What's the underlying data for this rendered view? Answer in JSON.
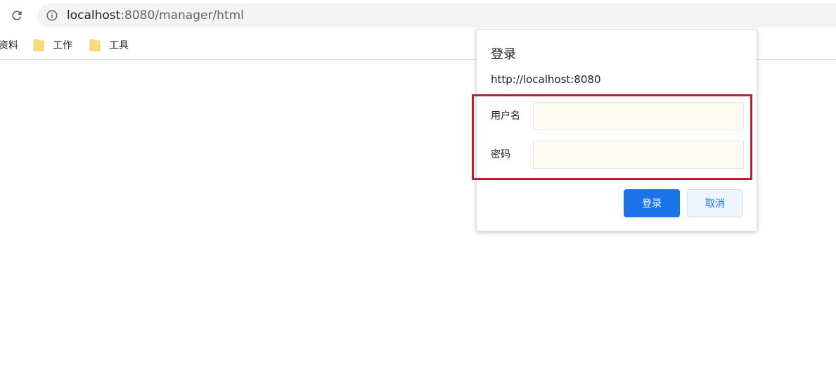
{
  "browser": {
    "url_host": "localhost",
    "url_rest": ":8080/manager/html"
  },
  "bookmarks": [
    {
      "label": "资料"
    },
    {
      "label": "工作"
    },
    {
      "label": "工具"
    }
  ],
  "dialog": {
    "title": "登录",
    "origin": "http://localhost:8080",
    "username_label": "用户名",
    "username_value": "",
    "password_label": "密码",
    "password_value": "",
    "submit_label": "登录",
    "cancel_label": "取消"
  },
  "colors": {
    "accent": "#1a73e8",
    "highlight_border": "#b22234",
    "input_bg": "#fffcf3"
  }
}
